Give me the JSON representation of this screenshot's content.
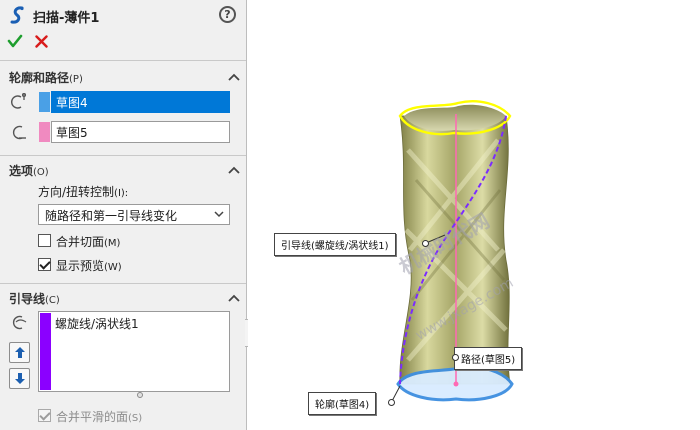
{
  "window": {
    "title": "扫描-薄件1"
  },
  "actions": {
    "help": "?"
  },
  "sections": {
    "profile_path": {
      "title": "轮廓和路径",
      "key": "(P)",
      "profile_value": "草图4",
      "path_value": "草图5",
      "profile_color": "#4aa0e6",
      "path_color": "#f08ac0"
    },
    "options": {
      "title": "选项",
      "key": "(O)",
      "orient_label": "方向/扭转控制",
      "orient_key": "(I):",
      "orient_selected": "随路径和第一引导线变化",
      "merge_tangent_label": "合并切面",
      "merge_tangent_key": "(M)",
      "merge_tangent_checked": false,
      "show_preview_label": "显示预览",
      "show_preview_key": "(W)",
      "show_preview_checked": true
    },
    "guides": {
      "title": "引导线",
      "key": "(C)",
      "items": [
        "螺旋线/涡状线1"
      ],
      "guide_color": "#8b00ff",
      "merge_smooth_label": "合并平滑的面",
      "merge_smooth_key": "(S)",
      "merge_smooth_checked": true,
      "merge_smooth_disabled": true
    }
  },
  "viewport": {
    "callouts": {
      "guide": "引导线(螺旋线/涡状线1)",
      "path": "路径(草图5)",
      "profile": "轮廓(草图4)"
    },
    "watermark": "机械时代网",
    "watermark_url": "www.jxage.com",
    "colors": {
      "profile_top": "#ffff00",
      "profile_bottom": "#3d8ee0",
      "guide_curve": "#7b2cff",
      "path_line": "#ff69b4",
      "body": "#c9c986"
    }
  }
}
